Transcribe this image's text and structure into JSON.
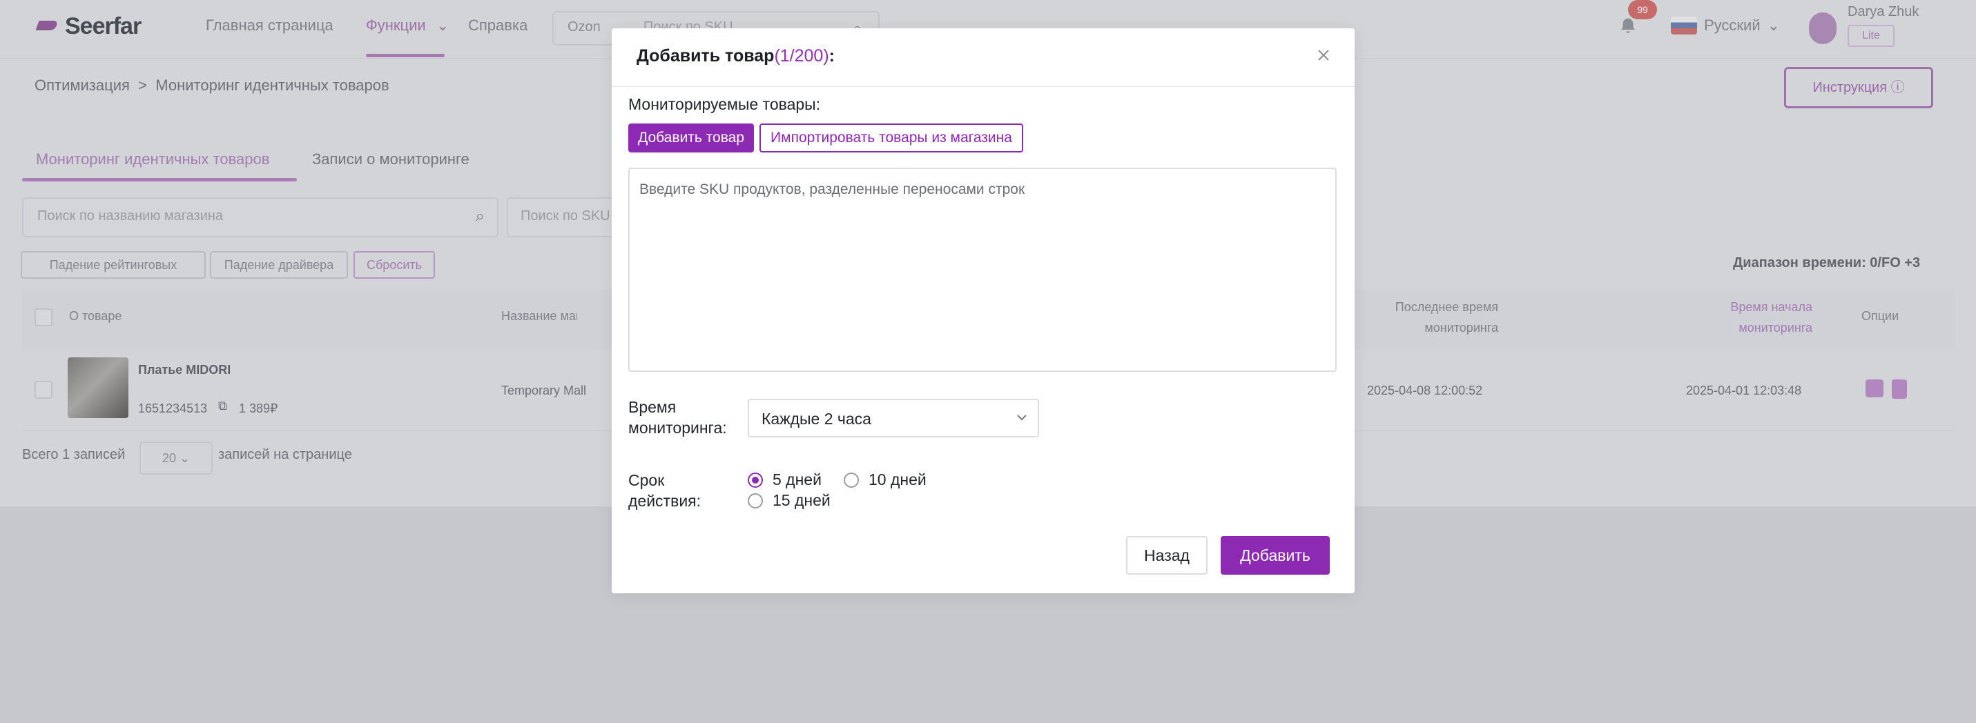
{
  "app": {
    "logo_text": "Seerfar",
    "nav": [
      "Главная страница",
      "Функции",
      "Справка"
    ],
    "search_select": "Ozon",
    "search_placeholder": "Поиск по SKU",
    "notification_count": "99",
    "language": "Русский",
    "user_name": "Daryа Zhuk",
    "user_tag": "Lite",
    "breadcrumb": [
      "Оптимизация",
      "Мониторинг идентичных товаров"
    ],
    "instructions_button": "Инструкция",
    "tabs": [
      "Мониторинг идентичных товаров",
      "Записи о мониторинге"
    ],
    "shop_search_placeholder": "Поиск по названию магазина",
    "sku_search_placeholder": "Поиск по SKU",
    "filter_chips": [
      "Падение рейтинговых",
      "Падение драйвера",
      "Сбросить"
    ],
    "time_range_label": "Диапазон времени: 0/FO +3",
    "table_headers": [
      "О товаре",
      "Название магазина",
      "Последнее время мониторинга",
      "Время начала мониторинга",
      "Опции"
    ],
    "row": {
      "title": "Платье MIDORI",
      "sku": "1651234513",
      "price": "1 389₽",
      "shop": "Temporary Mall",
      "last_monitoring": "2025-04-08 12:00:52",
      "start_monitoring": "2025-04-01 12:03:48"
    },
    "pager": {
      "total": "Всего 1 записей",
      "per_page": "20",
      "per_page_suffix": "записей на странице"
    }
  },
  "modal": {
    "title": "Добавить товар",
    "count": "(1/200)",
    "title_suffix": ":",
    "monitored_label": "Мониторируемые товары:",
    "add_product_button": "Добавить товар",
    "import_button": "Импортировать товары из магазина",
    "sku_placeholder": "Введите SKU продуктов, разделенные переносами строк",
    "time_label_line1": "Время",
    "time_label_line2": "мониторинга:",
    "time_value": "Каждые 2 часа",
    "period_label_line1": "Срок",
    "period_label_line2": "действия:",
    "period_options": [
      "5 дней",
      "10 дней",
      "15 дней"
    ],
    "period_selected": "5 дней",
    "back_button": "Назад",
    "add_button": "Добавить"
  },
  "colors": {
    "accent": "#8d2ab4",
    "overlay": "#c6c8cd"
  },
  "icons": [
    "close-icon",
    "chevron-down-icon",
    "search-icon",
    "bell-icon"
  ]
}
